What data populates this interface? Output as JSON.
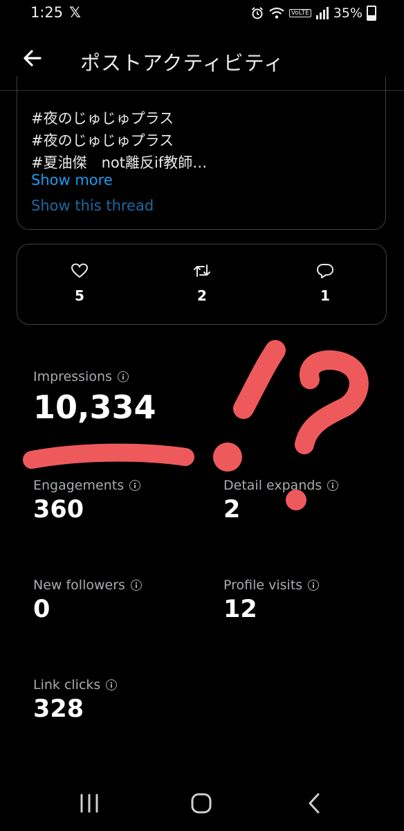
{
  "status_bar": {
    "time": "1:25",
    "app_logo": "𝕏",
    "volte": "VoLTE",
    "battery_percent": "35%"
  },
  "header": {
    "title": "ポストアクティビティ"
  },
  "post": {
    "lines": [
      "#夜のじゅじゅプラス",
      "#夜のじゅじゅプラス",
      "#夏油傑　not離反if教師…"
    ],
    "show_more": "Show more",
    "show_thread": "Show this thread"
  },
  "engagement": {
    "likes": "5",
    "reposts": "2",
    "replies": "1"
  },
  "metrics": {
    "impressions": {
      "label": "Impressions",
      "value": "10,334"
    },
    "engagements": {
      "label": "Engagements",
      "value": "360"
    },
    "detail_expands": {
      "label": "Detail expands",
      "value": "2"
    },
    "new_followers": {
      "label": "New followers",
      "value": "0"
    },
    "profile_visits": {
      "label": "Profile visits",
      "value": "12"
    },
    "link_clicks": {
      "label": "Link clicks",
      "value": "328"
    }
  },
  "colors": {
    "background": "#000000",
    "link": "#1d9bf0",
    "doodle": "#ee5a5c"
  }
}
